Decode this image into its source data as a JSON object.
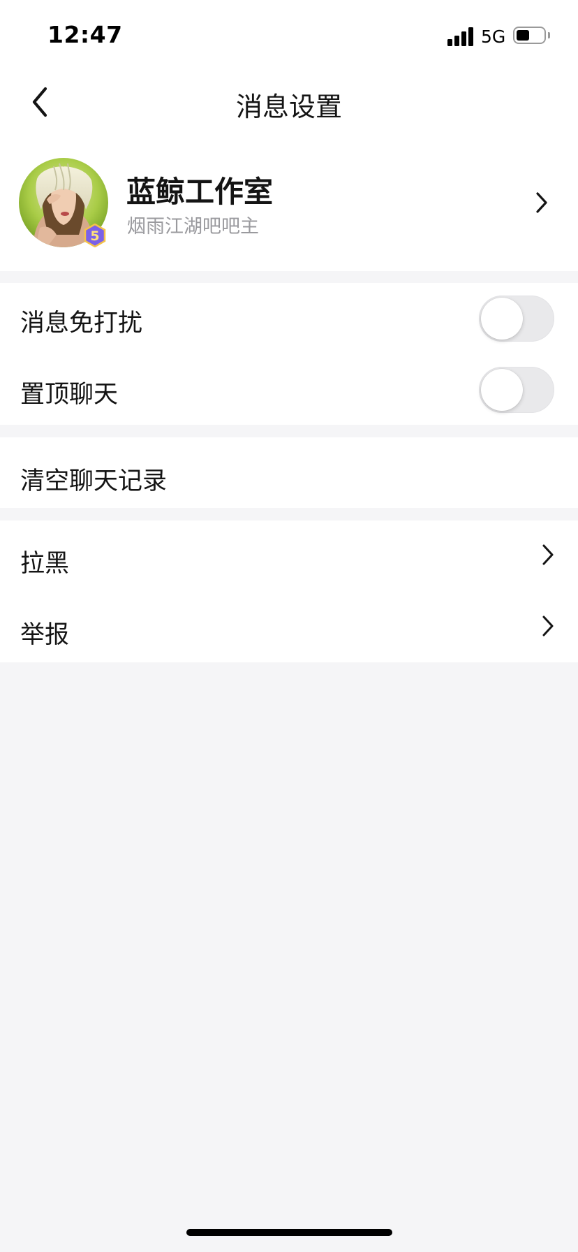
{
  "status_bar": {
    "time": "12:47",
    "network": "5G",
    "icons": [
      "signal-bars-icon",
      "battery-icon"
    ],
    "battery_level": 0.5
  },
  "nav": {
    "back_icon": "chevron-left-icon",
    "title": "消息设置"
  },
  "profile": {
    "name": "蓝鲸工作室",
    "subtitle": "烟雨江湖吧吧主",
    "level_badge": "5",
    "chevron_icon": "chevron-right-icon"
  },
  "settings": {
    "do_not_disturb": {
      "label": "消息免打扰",
      "enabled": false
    },
    "pin_chat": {
      "label": "置顶聊天",
      "enabled": false
    },
    "clear_history": {
      "label": "清空聊天记录"
    },
    "block": {
      "label": "拉黑",
      "icon": "chevron-right-icon"
    },
    "report": {
      "label": "举报",
      "icon": "chevron-right-icon"
    }
  },
  "colors": {
    "background": "#f5f5f7",
    "card": "#ffffff",
    "toggle_off": "#e9e9eb",
    "secondary_text": "#9a9a9e",
    "badge": "#6a55d6"
  }
}
